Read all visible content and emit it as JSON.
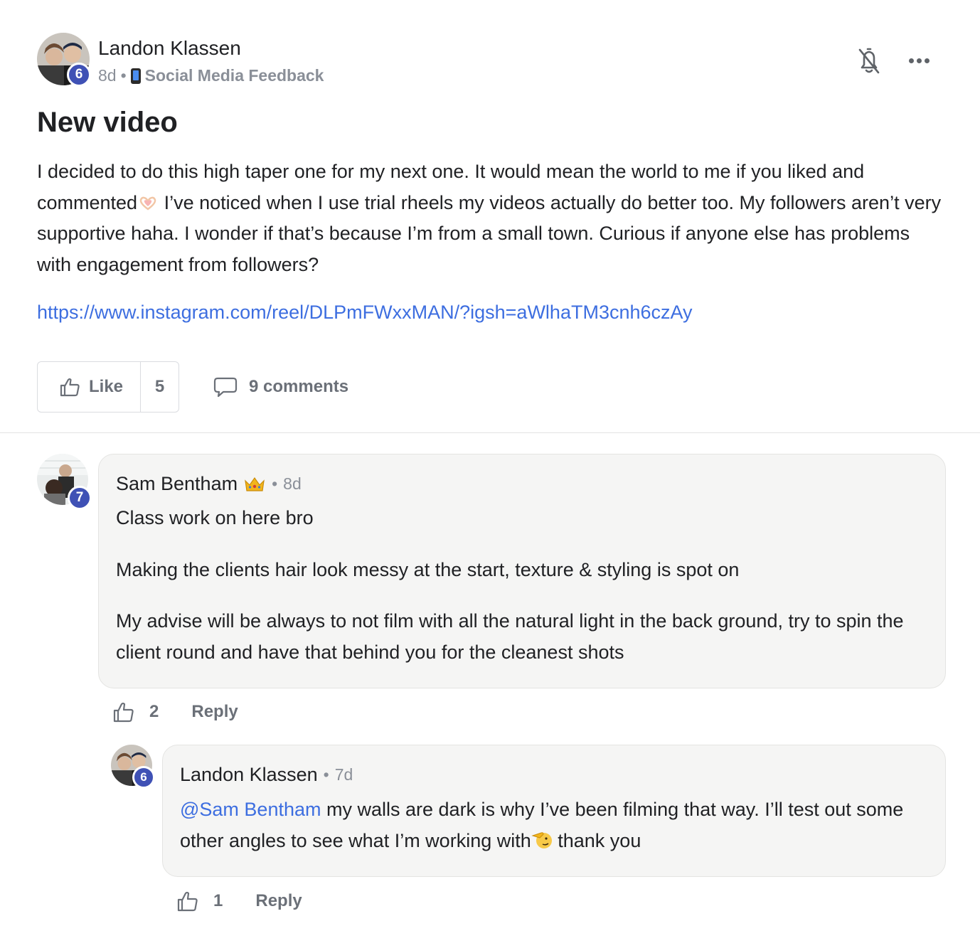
{
  "post": {
    "author": "Landon Klassen",
    "author_level": "6",
    "age": "8d",
    "separator": "•",
    "category": "Social Media Feedback",
    "title": "New video",
    "body_before_emoji": "I decided to do this high taper one for my next one. It would mean the world to me if you liked and commented",
    "body_emoji_icon": "heart-hands-emoji",
    "body_after_emoji": " I’ve noticed when I use trial rheels my videos actually do better too. My followers aren’t very supportive haha. I wonder if that’s because I’m from a small town. Curious if anyone else has problems with engagement from followers?",
    "link": "https://www.instagram.com/reel/DLPmFWxxMAN/?igsh=aWlhaTM3cnh6czAy",
    "like_label": "Like",
    "like_count": "5",
    "comments_label": "9 comments"
  },
  "comments": [
    {
      "author": "Sam Bentham",
      "author_level": "7",
      "badge_icon": "crown-emoji",
      "separator": "•",
      "age": "8d",
      "paragraphs": [
        "Class work on here bro",
        "Making the clients hair look messy at the start, texture & styling is spot on",
        "My advise will be always to not film with all the natural light in the back ground, try to spin the client round and have that behind you for the cleanest shots"
      ],
      "like_count": "2",
      "reply_label": "Reply"
    },
    {
      "author": "Landon Klassen",
      "author_level": "6",
      "separator": "•",
      "age": "7d",
      "mention": "@Sam Bentham",
      "text_before_emoji": " my walls are dark is why I’ve been filming that way. I’ll test out some other angles to see what I’m working with",
      "emoji_icon": "saluting-face-emoji",
      "text_after_emoji": " thank you",
      "like_count": "1",
      "reply_label": "Reply"
    }
  ],
  "colors": {
    "link": "#3d6ee0",
    "level_badge": "#3f51b5",
    "muted": "#8a8f98",
    "bubble_bg": "#f5f5f4"
  }
}
